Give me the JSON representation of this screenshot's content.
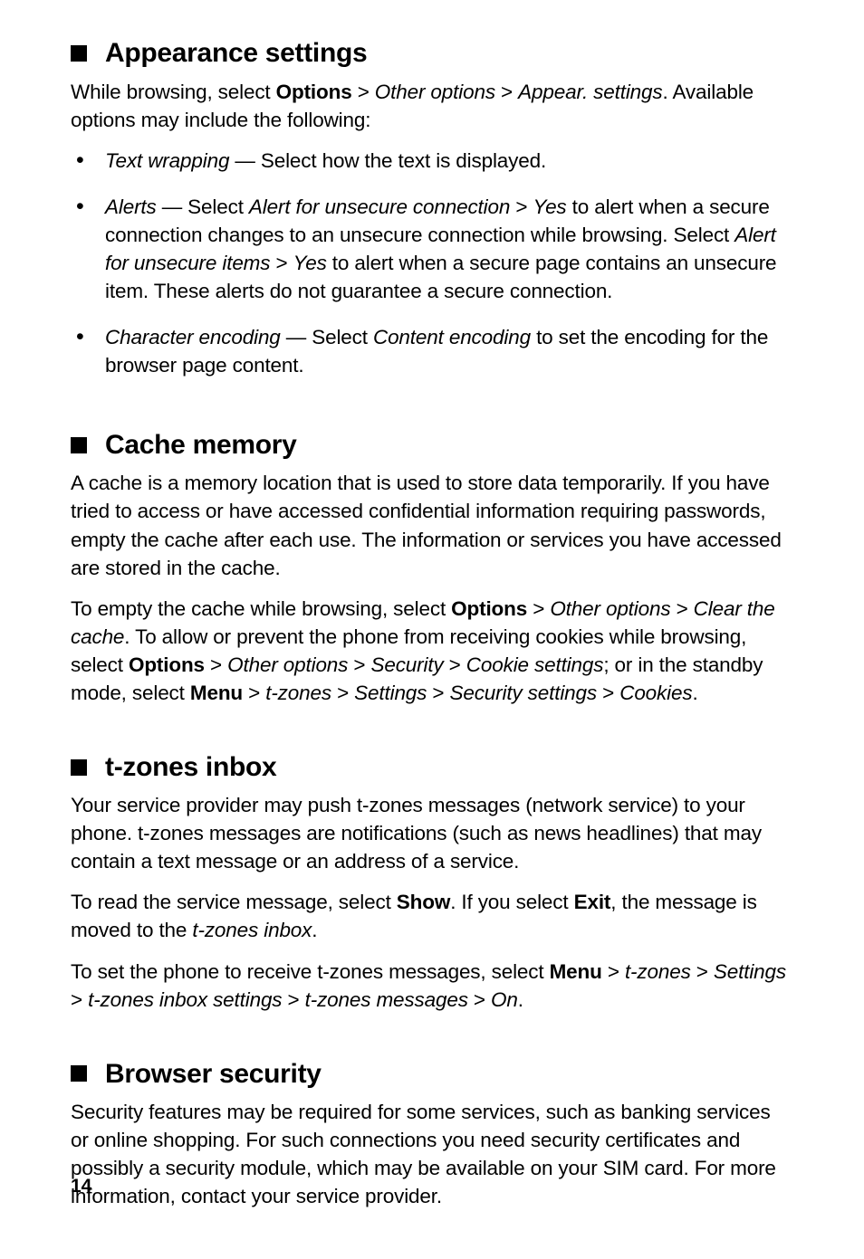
{
  "page_number": "14",
  "sections": {
    "appearance": {
      "title": "Appearance settings",
      "intro": {
        "t1": "While browsing, select ",
        "t2": "Options",
        "t3": " > ",
        "t4": "Other options",
        "t5": " > ",
        "t6": "Appear. settings",
        "t7": ". Available options may include the following:"
      },
      "items": {
        "text_wrapping": {
          "a": "Text wrapping",
          "b": " — Select how the text is displayed."
        },
        "alerts": {
          "a": "Alerts",
          "b": " — Select ",
          "c": "Alert for unsecure connection",
          "d": " > ",
          "e": "Yes",
          "f": " to alert when a secure connection changes to an unsecure connection while browsing. Select ",
          "g": "Alert for unsecure items",
          "h": " > ",
          "i": "Yes",
          "j": " to alert when a secure page contains an unsecure item. These alerts do not guarantee a secure connection."
        },
        "char_enc": {
          "a": "Character encoding",
          "b": " — Select ",
          "c": "Content encoding",
          "d": " to set the encoding for the browser page content."
        }
      }
    },
    "cache": {
      "title": "Cache memory",
      "p1": "A cache is a memory location that is used to store data temporarily. If you have tried to access or have accessed confidential information requiring passwords, empty the cache after each use. The information or services you have accessed are stored in the cache.",
      "p2": {
        "a": "To empty the cache while browsing, select ",
        "b": "Options",
        "c": " > ",
        "d": "Other options",
        "e": " > ",
        "f": "Clear the cache",
        "g": ". To allow or prevent the phone from receiving cookies while browsing, select ",
        "h": "Options",
        "i": " > ",
        "j": "Other options",
        "k": " > ",
        "l": "Security",
        "m": " > ",
        "n": "Cookie settings",
        "o": "; or in the standby mode, select ",
        "p": "Menu",
        "q": " > ",
        "r": "t-zones",
        "s": " > ",
        "t": "Settings",
        "u": " > ",
        "v": "Security settings",
        "w": " > ",
        "x": "Cookies",
        "y": "."
      }
    },
    "tzones": {
      "title": "t-zones inbox",
      "p1": "Your service provider may push t-zones messages (network service) to your phone. t-zones messages are notifications (such as news headlines) that may contain a text message or an address of a service.",
      "p2": {
        "a": "To read the service message, select ",
        "b": "Show",
        "c": ". If you select ",
        "d": "Exit",
        "e": ", the message is moved to the ",
        "f": "t-zones inbox",
        "g": "."
      },
      "p3": {
        "a": "To set the phone to receive t-zones messages, select ",
        "b": "Menu",
        "c": " > ",
        "d": "t-zones",
        "e": " > ",
        "f": "Settings",
        "g": " > ",
        "h": "t-zones inbox settings",
        "i": " > ",
        "j": "t-zones messages",
        "k": " > ",
        "l": "On",
        "m": "."
      }
    },
    "security": {
      "title": "Browser security",
      "p1": "Security features may be required for some services, such as banking services or online shopping. For such connections you need security certificates and possibly a security module, which may be available on your SIM card. For more information, contact your service provider."
    }
  }
}
